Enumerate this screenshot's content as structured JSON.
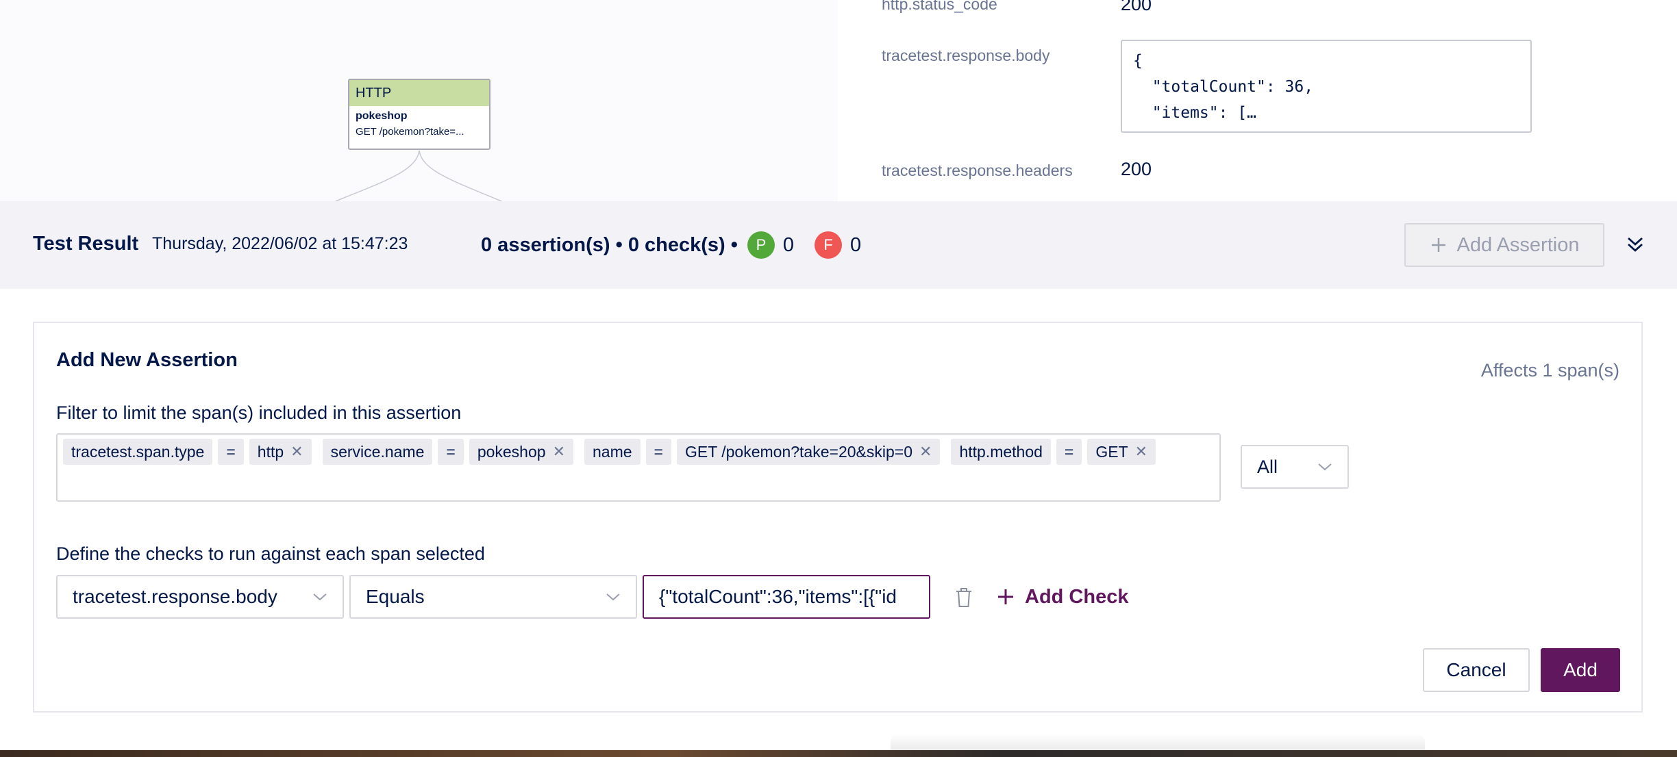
{
  "diagram": {
    "node": {
      "type_label": "HTTP",
      "service": "pokeshop",
      "name": "GET /pokemon?take=...",
      "header_color": "#c8dda1"
    }
  },
  "attributes": {
    "status_code_key": "http.status_code",
    "status_code_value": "200",
    "body_key": "tracetest.response.body",
    "body_value": "{\n  \"totalCount\": 36,\n  \"items\": […\n    {",
    "headers_key": "tracetest.response.headers",
    "headers_value": "200"
  },
  "result_bar": {
    "title": "Test Result",
    "date": "Thursday, 2022/06/02 at 15:47:23",
    "summary": "0 assertion(s) • 0 check(s) •",
    "passed_letter": "P",
    "passed_count": "0",
    "failed_letter": "F",
    "failed_count": "0",
    "add_assertion_label": "Add Assertion",
    "pass_color": "#52a839",
    "fail_color": "#ef5654"
  },
  "form": {
    "title": "Add New Assertion",
    "affects": "Affects 1 span(s)",
    "filter_label": "Filter to limit the span(s) included in this assertion",
    "filters": [
      {
        "key": "tracetest.span.type",
        "op": "=",
        "value": "http"
      },
      {
        "key": "service.name",
        "op": "=",
        "value": "pokeshop"
      },
      {
        "key": "name",
        "op": "=",
        "value": "GET /pokemon?take=20&skip=0"
      },
      {
        "key": "http.method",
        "op": "=",
        "value": "GET"
      }
    ],
    "scope_select": "All",
    "checks_label": "Define the checks to run against each span selected",
    "check_attribute": "tracetest.response.body",
    "check_operator": "Equals",
    "check_value": "{\"totalCount\":36,\"items\":[{\"id",
    "add_check_label": "Add Check",
    "cancel_label": "Cancel",
    "add_label": "Add",
    "accent_color": "#61175e"
  },
  "icons": {
    "remove_chip": "close-icon",
    "dropdown": "chevron-down-icon",
    "collapse": "double-chevron-down-icon",
    "delete": "trash-icon",
    "add": "plus-icon"
  }
}
